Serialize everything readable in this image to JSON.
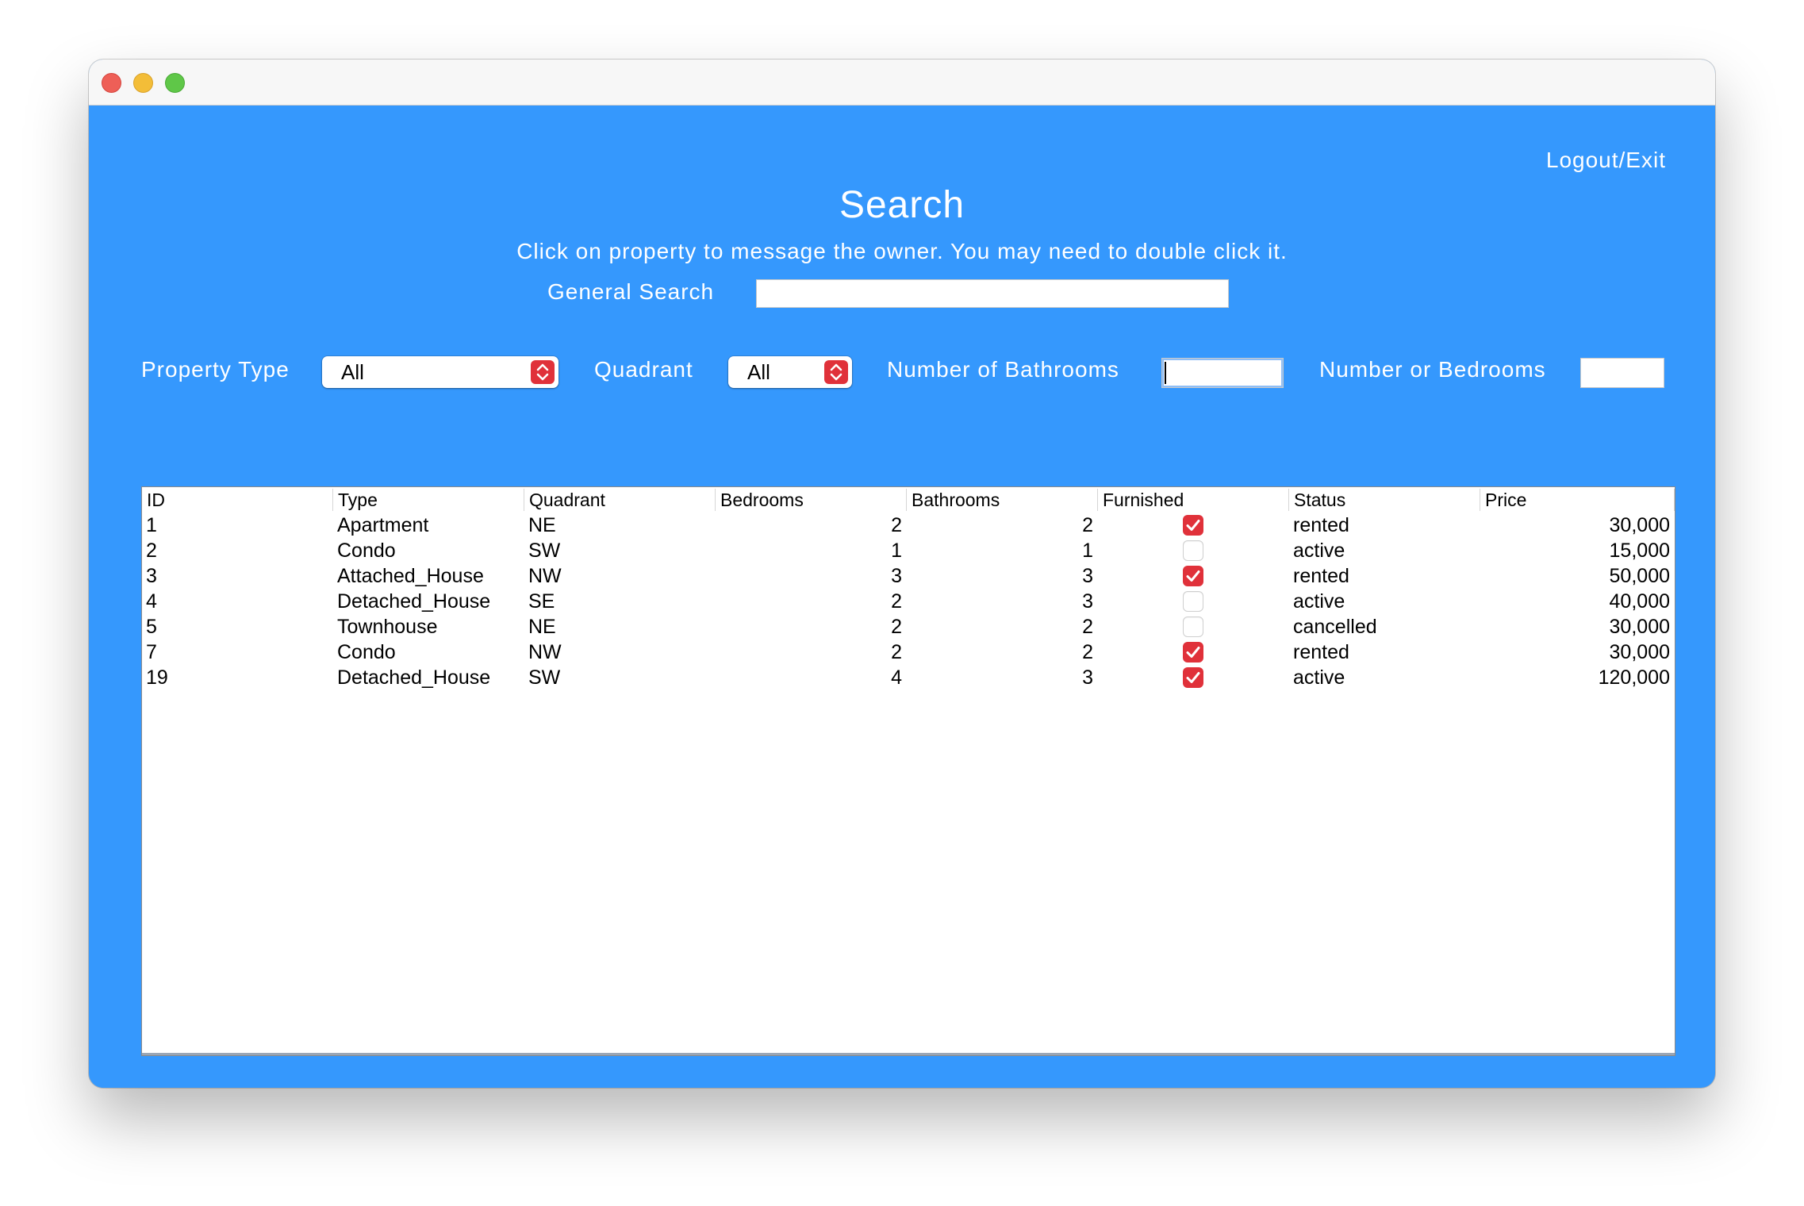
{
  "window": {
    "buttons": [
      "close",
      "minimize",
      "zoom"
    ]
  },
  "header": {
    "logout_label": "Logout/Exit",
    "title": "Search",
    "subtitle": "Click on property to message the owner. You may need to double click it."
  },
  "general_search": {
    "label": "General Search",
    "value": ""
  },
  "filters": {
    "property_type_label": "Property Type",
    "property_type_value": "All",
    "quadrant_label": "Quadrant",
    "quadrant_value": "All",
    "bathrooms_label": "Number of Bathrooms",
    "bathrooms_value": "",
    "bedrooms_label": "Number or Bedrooms",
    "bedrooms_value": ""
  },
  "table": {
    "columns": [
      "ID",
      "Type",
      "Quadrant",
      "Bedrooms",
      "Bathrooms",
      "Furnished",
      "Status",
      "Price"
    ],
    "rows": [
      {
        "id": "1",
        "type": "Apartment",
        "quadrant": "NE",
        "bedrooms": "2",
        "bathrooms": "2",
        "furnished": true,
        "status": "rented",
        "price": "30,000"
      },
      {
        "id": "2",
        "type": "Condo",
        "quadrant": "SW",
        "bedrooms": "1",
        "bathrooms": "1",
        "furnished": false,
        "status": "active",
        "price": "15,000"
      },
      {
        "id": "3",
        "type": "Attached_House",
        "quadrant": "NW",
        "bedrooms": "3",
        "bathrooms": "3",
        "furnished": true,
        "status": "rented",
        "price": "50,000"
      },
      {
        "id": "4",
        "type": "Detached_House",
        "quadrant": "SE",
        "bedrooms": "2",
        "bathrooms": "3",
        "furnished": false,
        "status": "active",
        "price": "40,000"
      },
      {
        "id": "5",
        "type": "Townhouse",
        "quadrant": "NE",
        "bedrooms": "2",
        "bathrooms": "2",
        "furnished": false,
        "status": "cancelled",
        "price": "30,000"
      },
      {
        "id": "7",
        "type": "Condo",
        "quadrant": "NW",
        "bedrooms": "2",
        "bathrooms": "2",
        "furnished": true,
        "status": "rented",
        "price": "30,000"
      },
      {
        "id": "19",
        "type": "Detached_House",
        "quadrant": "SW",
        "bedrooms": "4",
        "bathrooms": "3",
        "furnished": true,
        "status": "active",
        "price": "120,000"
      }
    ]
  },
  "colors": {
    "background": "#3598fd",
    "accent": "#e0313a"
  }
}
